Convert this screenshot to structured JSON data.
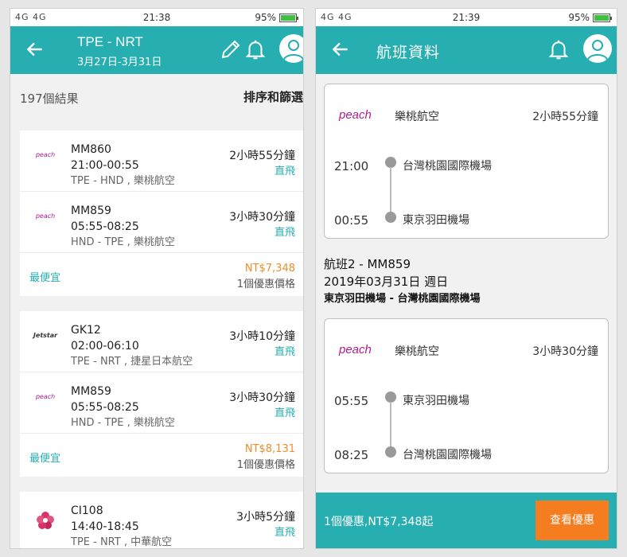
{
  "left": {
    "status": {
      "signal": "4G 4G",
      "time": "21:38",
      "battery": "95%",
      "battery_level": 0.95
    },
    "header": {
      "route": "TPE - NRT",
      "dates": "3月27日-3月31日"
    },
    "results": {
      "count": "197個結果",
      "sort_label": "排序和篩選"
    },
    "cards": [
      {
        "legs": [
          {
            "logo": "peach",
            "flight": "MM860",
            "time": "21:00-00:55",
            "detail": "TPE - HND , 樂桃航空",
            "duration": "2小時55分鐘",
            "type": "直飛"
          },
          {
            "logo": "peach",
            "flight": "MM859",
            "time": "05:55-08:25",
            "detail": "HND - TPE , 樂桃航空",
            "duration": "3小時30分鐘",
            "type": "直飛"
          }
        ],
        "tag": "最便宜",
        "price": "NT$7,348",
        "deals": "1個優惠價格"
      },
      {
        "legs": [
          {
            "logo": "Jetstar",
            "flight": "GK12",
            "time": "02:00-06:10",
            "detail": "TPE - NRT , 捷星日本航空",
            "duration": "3小時10分鐘",
            "type": "直飛"
          },
          {
            "logo": "peach",
            "flight": "MM859",
            "time": "05:55-08:25",
            "detail": "HND - TPE , 樂桃航空",
            "duration": "3小時30分鐘",
            "type": "直飛"
          }
        ],
        "tag": "最便宜",
        "price": "NT$8,131",
        "deals": "1個優惠價格"
      },
      {
        "legs": [
          {
            "logo": "china-airlines",
            "flight": "CI108",
            "time": "14:40-18:45",
            "detail": "TPE - NRT , 中華航空",
            "duration": "3小時5分鐘",
            "type": "直飛"
          }
        ]
      }
    ]
  },
  "right": {
    "status": {
      "signal": "4G 4G",
      "time": "21:39",
      "battery": "95%",
      "battery_level": 0.95
    },
    "header": {
      "title": "航班資料"
    },
    "segment1": {
      "airline_logo": "peach",
      "airline": "樂桃航空",
      "duration": "2小時55分鐘",
      "dep_time": "21:00",
      "dep_airport": "台灣桃園國際機場",
      "arr_time": "00:55",
      "arr_airport": "東京羽田機場"
    },
    "flight2": {
      "label": "航班2 -  MM859",
      "date": "2019年03月31日 週日",
      "route": "東京羽田機場 - 台灣桃園國際機場"
    },
    "segment2": {
      "airline_logo": "peach",
      "airline": "樂桃航空",
      "duration": "3小時30分鐘",
      "dep_time": "05:55",
      "dep_airport": "東京羽田機場",
      "arr_time": "08:25",
      "arr_airport": "台灣桃園國際機場"
    },
    "footer": {
      "summary": "1個優惠,NT$7,348起",
      "button": "查看優惠"
    }
  },
  "colors": {
    "teal": "#26aeb0",
    "orange": "#f57c1f",
    "price": "#f28c28",
    "peach": "#b01b8d"
  }
}
